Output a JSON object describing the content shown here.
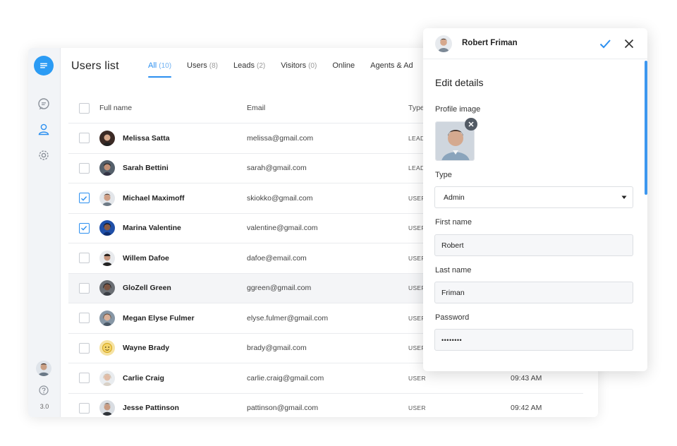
{
  "app": {
    "title": "Users list",
    "version": "3.0"
  },
  "tabs": [
    {
      "label": "All",
      "count": "(10)"
    },
    {
      "label": "Users",
      "count": "(8)"
    },
    {
      "label": "Leads",
      "count": "(2)"
    },
    {
      "label": "Visitors",
      "count": "(0)"
    },
    {
      "label": "Online",
      "count": ""
    },
    {
      "label": "Agents & Ad",
      "count": ""
    }
  ],
  "table": {
    "headers": {
      "full_name": "Full name",
      "email": "Email",
      "type": "Type"
    },
    "rows": [
      {
        "name": "Melissa Satta",
        "email": "melissa@gmail.com",
        "type": "LEAD",
        "time": "",
        "checked": false
      },
      {
        "name": "Sarah Bettini",
        "email": "sarah@gmail.com",
        "type": "LEAD",
        "time": "",
        "checked": false
      },
      {
        "name": "Michael Maximoff",
        "email": "skiokko@gmail.com",
        "type": "USER",
        "time": "",
        "checked": true
      },
      {
        "name": "Marina Valentine",
        "email": "valentine@gmail.com",
        "type": "USER",
        "time": "",
        "checked": true
      },
      {
        "name": "Willem Dafoe",
        "email": "dafoe@email.com",
        "type": "USER",
        "time": "",
        "checked": false
      },
      {
        "name": "GloZell Green",
        "email": "ggreen@gmail.com",
        "type": "USER",
        "time": "",
        "checked": false
      },
      {
        "name": "Megan Elyse Fulmer",
        "email": "elyse.fulmer@gmail.com",
        "type": "USER",
        "time": "",
        "checked": false
      },
      {
        "name": "Wayne Brady",
        "email": "brady@gmail.com",
        "type": "USER",
        "time": "",
        "checked": false
      },
      {
        "name": "Carlie Craig",
        "email": "carlie.craig@gmail.com",
        "type": "USER",
        "time": "09:43 AM",
        "checked": false
      },
      {
        "name": "Jesse Pattinson",
        "email": "pattinson@gmail.com",
        "type": "USER",
        "time": "09:42 AM",
        "checked": false
      }
    ]
  },
  "panel": {
    "user_name": "Robert Friman",
    "section_title": "Edit details",
    "profile_image_label": "Profile image",
    "type_label": "Type",
    "type_value": "Admin",
    "first_name_label": "First name",
    "first_name_value": "Robert",
    "last_name_label": "Last name",
    "last_name_value": "Friman",
    "password_label": "Password",
    "password_value": "••••••••"
  },
  "colors": {
    "accent": "#2b8ff0",
    "logo": "#2b9bf4"
  },
  "icons": {
    "logo": "chat-bubble-lines-icon",
    "sidebar": [
      "conversations-icon",
      "users-icon",
      "settings-gear-icon",
      "help-icon"
    ],
    "panel": [
      "check-icon",
      "close-icon",
      "remove-image-icon",
      "dropdown-caret-icon"
    ]
  }
}
